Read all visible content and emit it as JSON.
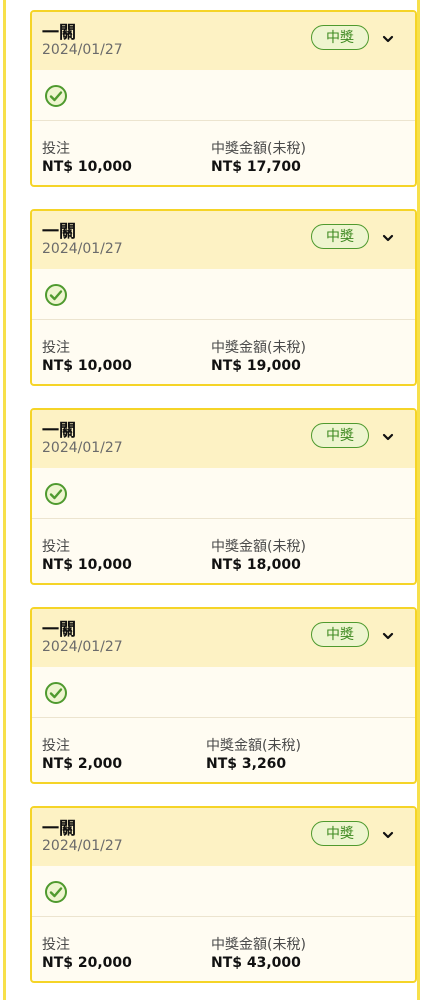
{
  "cards": [
    {
      "title": "一關",
      "date": "2024/01/27",
      "status": "中獎",
      "stake_label": "投注",
      "stake_value": "NT$ 10,000",
      "payout_label": "中獎金額(未稅)",
      "payout_value": "NT$ 17,700"
    },
    {
      "title": "一關",
      "date": "2024/01/27",
      "status": "中獎",
      "stake_label": "投注",
      "stake_value": "NT$ 10,000",
      "payout_label": "中獎金額(未稅)",
      "payout_value": "NT$ 19,000"
    },
    {
      "title": "一關",
      "date": "2024/01/27",
      "status": "中獎",
      "stake_label": "投注",
      "stake_value": "NT$ 10,000",
      "payout_label": "中獎金額(未稅)",
      "payout_value": "NT$ 18,000"
    },
    {
      "title": "一關",
      "date": "2024/01/27",
      "status": "中獎",
      "stake_label": "投注",
      "stake_value": "NT$ 2,000",
      "payout_label": "中獎金額(未稅)",
      "payout_value": "NT$ 3,260"
    },
    {
      "title": "一關",
      "date": "2024/01/27",
      "status": "中獎",
      "stake_label": "投注",
      "stake_value": "NT$ 20,000",
      "payout_label": "中獎金額(未稅)",
      "payout_value": "NT$ 43,000"
    }
  ],
  "icons": {
    "status_check": "check-circle-icon",
    "expand": "chevron-down-icon"
  },
  "colors": {
    "card_border": "#f5d427",
    "card_header": "#fdf2c4",
    "card_body": "#fffcf2",
    "win_badge": "#4f9a2f"
  }
}
